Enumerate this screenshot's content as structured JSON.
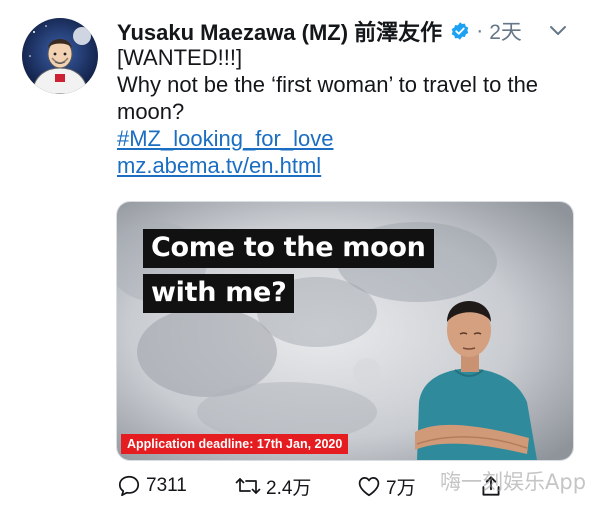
{
  "tweet": {
    "display_name": "Yusaku Maezawa (MZ) 前澤友作",
    "separator": "·",
    "time": "2天",
    "lines": [
      "[WANTED!!!]",
      "Why not be the ‘first woman’ to travel to the",
      "moon?"
    ],
    "links": [
      "#MZ_looking_for_love",
      "mz.abema.tv/en.html"
    ]
  },
  "media": {
    "headline_1": "Come to the moon",
    "headline_2": "with me?",
    "deadline": "Application deadline: 17th Jan, 2020"
  },
  "actions": {
    "reply_count": "7311",
    "retweet_count": "2.4万",
    "like_count": "7万"
  },
  "watermark": "嗨一刻娱乐App",
  "colors": {
    "verified": "#1da1f2",
    "link": "#1b6ec2",
    "deadline_bg": "#e51d20"
  },
  "icons": [
    "verified-icon",
    "chevron-down-icon",
    "reply-icon",
    "retweet-icon",
    "like-icon",
    "share-icon"
  ]
}
